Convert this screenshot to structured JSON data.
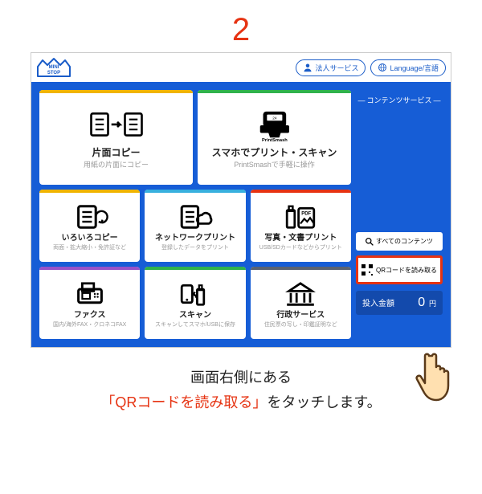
{
  "step_number": "2",
  "header": {
    "logo_text_top": "MINI",
    "logo_text_bottom": "STOP",
    "corporate_label": "法人サービス",
    "language_label": "Language/言語"
  },
  "side": {
    "title": "コンテンツサービス",
    "all_contents_label": "すべてのコンテンツ",
    "qr_label": "QRコードを読み取る",
    "deposit_label": "投入金額",
    "deposit_amount": "0",
    "deposit_unit": "円"
  },
  "tiles": {
    "big1": {
      "title": "片面コピー",
      "sub": "用紙の片面にコピー",
      "color": "#f0b400"
    },
    "big2": {
      "title": "スマホでプリント・スキャン",
      "sub": "PrintSmashで手軽に操作",
      "color": "#2fb24c"
    },
    "s1": {
      "title": "いろいろコピー",
      "sub": "両面・拡大縮小・免許証など",
      "color": "#f0b400"
    },
    "s2": {
      "title": "ネットワークプリント",
      "sub": "登録したデータをプリント",
      "color": "#38b0de"
    },
    "s3": {
      "title": "写真・文書プリント",
      "sub": "USB/SDカードなどからプリント",
      "color": "#e63312"
    },
    "s4": {
      "title": "ファクス",
      "sub": "国内/海外FAX・クロネコFAX",
      "color": "#9652c9"
    },
    "s5": {
      "title": "スキャン",
      "sub": "スキャンしてスマホ/USBに保存",
      "color": "#2fb24c"
    },
    "s6": {
      "title": "行政サービス",
      "sub": "住民票の写し・印鑑証明など",
      "color": "#5a6270"
    }
  },
  "caption": {
    "line1": "画面右側にある",
    "emphasis": "「QRコードを読み取る」",
    "line2_rest": "をタッチします。"
  }
}
